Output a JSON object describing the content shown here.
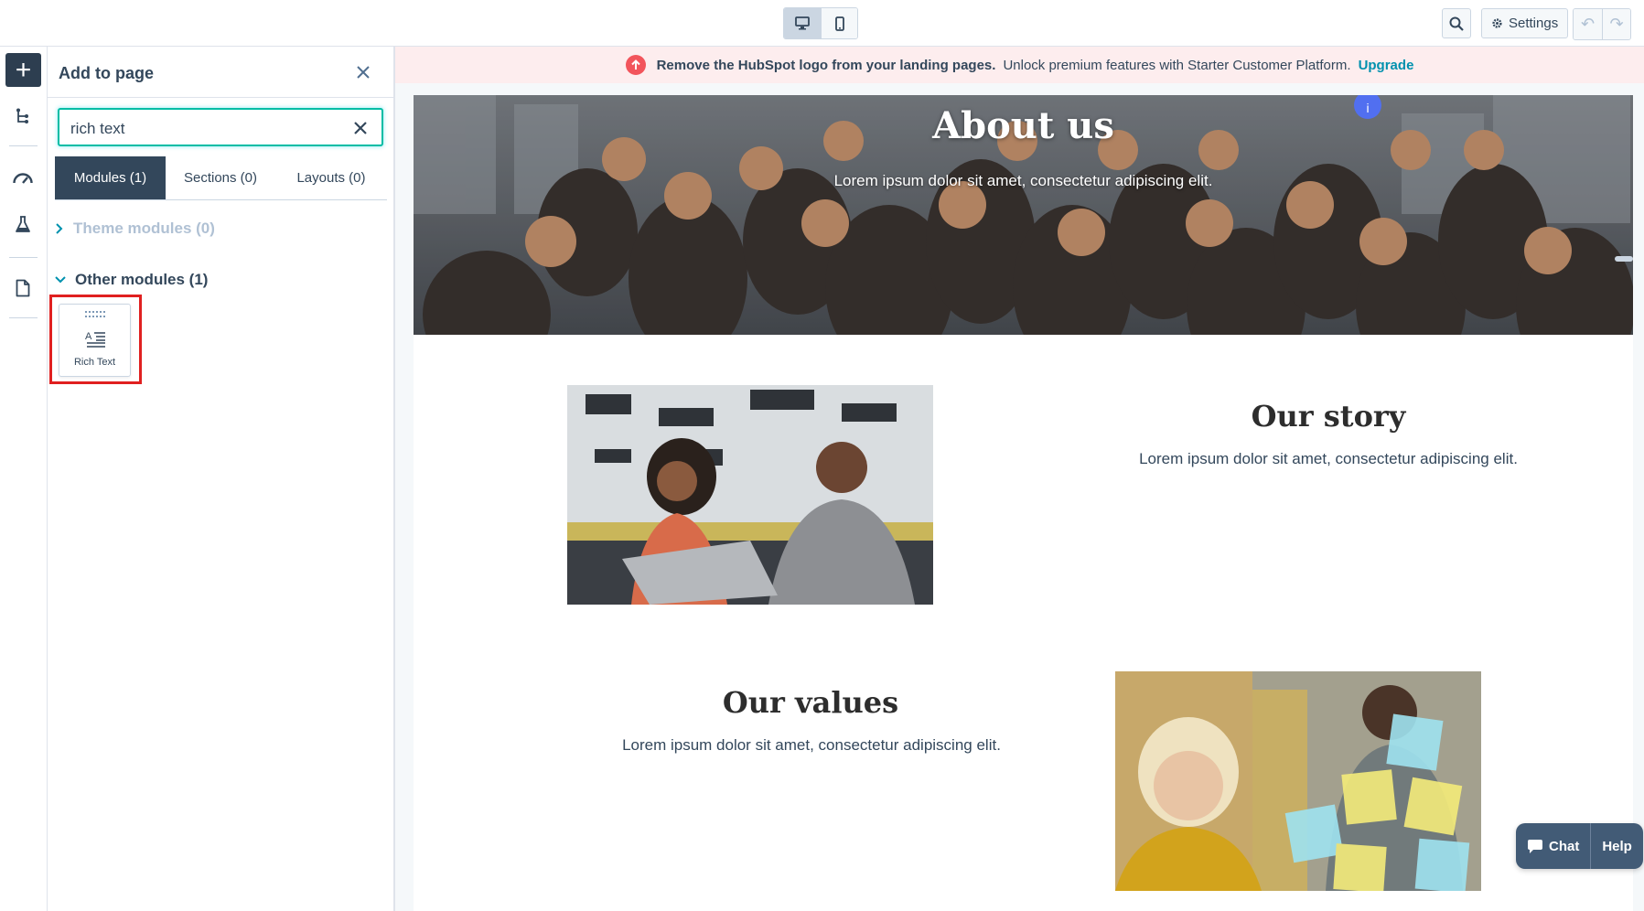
{
  "topbar": {
    "device_desktop_icon": "desktop-icon",
    "device_mobile_icon": "mobile-icon",
    "search_icon": "search-icon",
    "settings_label": "Settings",
    "undo_icon": "undo-icon",
    "redo_icon": "redo-icon"
  },
  "rail": {
    "add_icon": "plus-icon",
    "items": [
      "tree-icon",
      "gauge-icon",
      "flask-icon",
      "document-icon"
    ]
  },
  "panel": {
    "title": "Add to page",
    "search": {
      "value": "rich text",
      "placeholder": "Search"
    },
    "tabs": [
      {
        "label": "Modules (1)",
        "active": true
      },
      {
        "label": "Sections (0)",
        "active": false
      },
      {
        "label": "Layouts (0)",
        "active": false
      }
    ],
    "groups": [
      {
        "label": "Theme modules (0)",
        "expanded": false,
        "disabled": true
      },
      {
        "label": "Other modules (1)",
        "expanded": true,
        "disabled": false
      }
    ],
    "modules": [
      {
        "label": "Rich Text",
        "icon": "rich-text-icon"
      }
    ]
  },
  "preview": {
    "banner": {
      "bold": "Remove the HubSpot logo from your landing pages.",
      "text": "Unlock premium features with Starter Customer Platform.",
      "link": "Upgrade"
    },
    "hero": {
      "title": "About us",
      "subtitle": "Lorem ipsum dolor sit amet, consectetur adipiscing elit."
    },
    "story": {
      "title": "Our story",
      "text": "Lorem ipsum dolor sit amet, consectetur adipiscing elit."
    },
    "values": {
      "title": "Our values",
      "text": "Lorem ipsum dolor sit amet, consectetur adipiscing elit."
    }
  },
  "help_widget": {
    "chat_label": "Chat",
    "help_label": "Help"
  },
  "colors": {
    "accent": "#00bda5",
    "dark": "#33475b",
    "highlight": "#e02020",
    "upgrade": "#0091ae"
  }
}
